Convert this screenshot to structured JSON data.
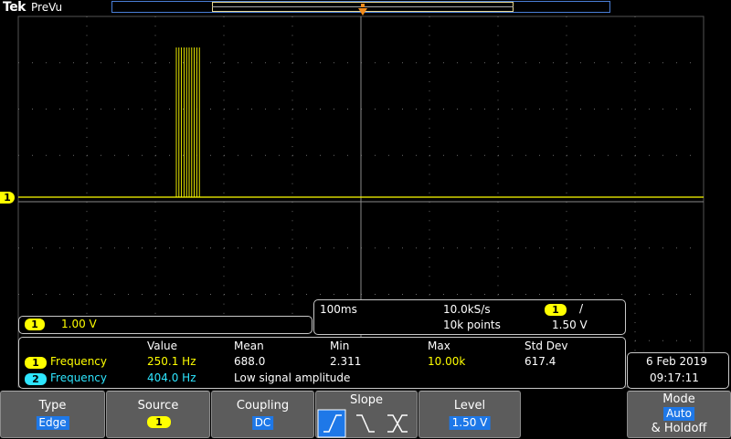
{
  "header": {
    "brand": "Tek",
    "acq_mode": "PreVu"
  },
  "channel1": {
    "marker": "1",
    "scale": "1.00 V",
    "color": "#ffff00"
  },
  "timebase": {
    "time_per_div": "100ms",
    "sample_rate": "10.0kS/s",
    "record_length": "10k points",
    "trigger_source": "1",
    "trigger_slope_symbol": "/",
    "trigger_level": "1.50 V"
  },
  "measurements": {
    "headers": [
      "Value",
      "Mean",
      "Min",
      "Max",
      "Std Dev"
    ],
    "rows": [
      {
        "channel": "1",
        "name": "Frequency",
        "value": "250.1 Hz",
        "mean": "688.0",
        "min": "2.311",
        "max": "10.00k",
        "std": "617.4",
        "color": "#ffff00"
      },
      {
        "channel": "2",
        "name": "Frequency",
        "value": "404.0 Hz",
        "note": "Low signal amplitude",
        "color": "#2ee6ff"
      }
    ]
  },
  "datetime": {
    "date": "6 Feb  2019",
    "time": "09:17:11"
  },
  "softkeys": {
    "type": {
      "title": "Type",
      "value": "Edge"
    },
    "source": {
      "title": "Source",
      "value": "1"
    },
    "coupling": {
      "title": "Coupling",
      "value": "DC"
    },
    "slope": {
      "title": "Slope"
    },
    "level": {
      "title": "Level",
      "value": "1.50 V"
    },
    "mode": {
      "title": "Mode",
      "value": "Auto",
      "sub": "& Holdoff"
    }
  }
}
